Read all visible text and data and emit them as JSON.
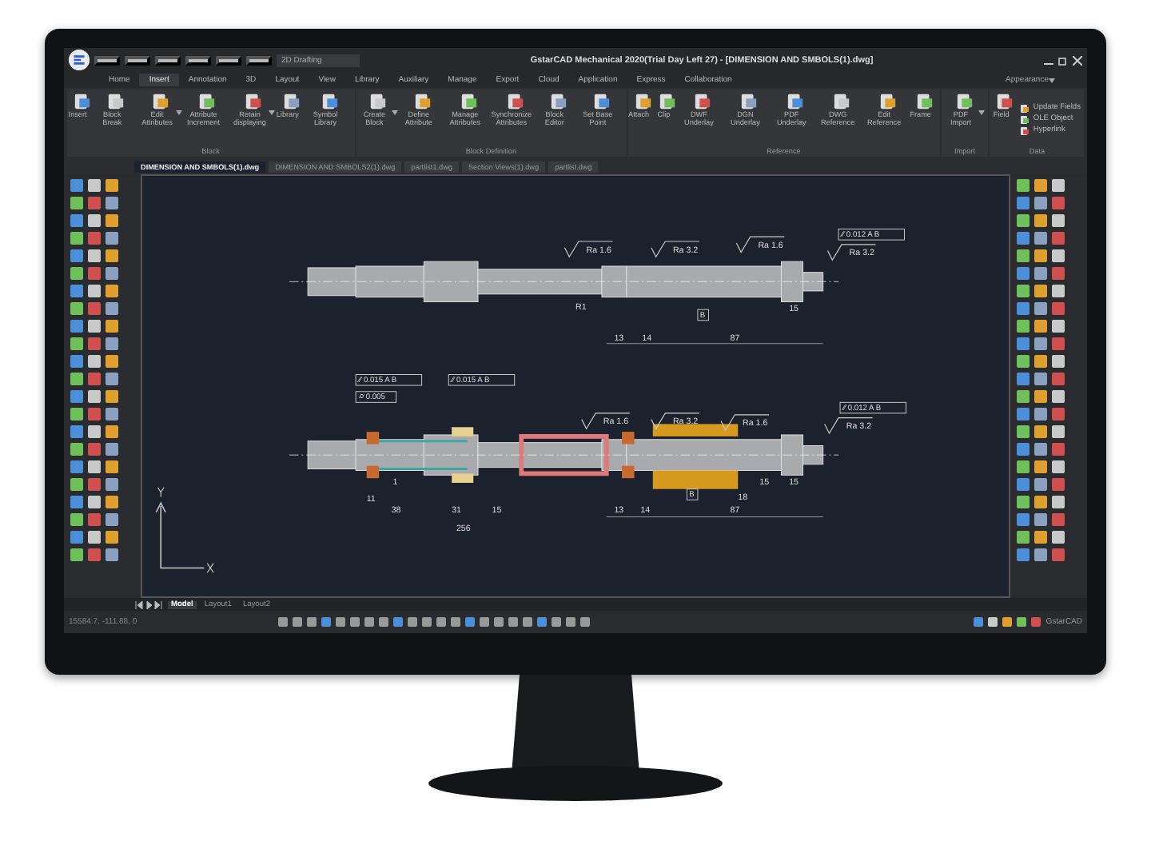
{
  "title_bar": {
    "workspace": "2D Drafting",
    "title": "GstarCAD Mechanical 2020(Trial Day Left 27) - [DIMENSION AND SMBOLS(1).dwg]"
  },
  "menu_tabs": [
    {
      "label": "Home",
      "selected": false
    },
    {
      "label": "Insert",
      "selected": true
    },
    {
      "label": "Annotation",
      "selected": false
    },
    {
      "label": "3D",
      "selected": false
    },
    {
      "label": "Layout",
      "selected": false
    },
    {
      "label": "View",
      "selected": false
    },
    {
      "label": "Library",
      "selected": false
    },
    {
      "label": "Auxiliary",
      "selected": false
    },
    {
      "label": "Manage",
      "selected": false
    },
    {
      "label": "Export",
      "selected": false
    },
    {
      "label": "Cloud",
      "selected": false
    },
    {
      "label": "Application",
      "selected": false
    },
    {
      "label": "Express",
      "selected": false
    },
    {
      "label": "Collaboration",
      "selected": false
    }
  ],
  "appearance": "Appearance",
  "ribbon_groups": [
    {
      "title": "Block",
      "buttons": [
        {
          "label": "Insert",
          "menu": false,
          "kind": "large"
        },
        {
          "label": "Block Break",
          "menu": false,
          "kind": "large"
        },
        {
          "label": "Edit Attributes",
          "menu": true,
          "kind": "large"
        },
        {
          "label": "Attribute Increment",
          "menu": false,
          "kind": "large"
        },
        {
          "label": "Retain displaying",
          "menu": true,
          "kind": "large"
        },
        {
          "label": "Library",
          "menu": false,
          "kind": "large"
        },
        {
          "label": "Symbol Library",
          "menu": false,
          "kind": "large"
        }
      ]
    },
    {
      "title": "Block Definition",
      "buttons": [
        {
          "label": "Create Block",
          "menu": true,
          "kind": "large"
        },
        {
          "label": "Define Attribute",
          "menu": false,
          "kind": "large"
        },
        {
          "label": "Manage Attributes",
          "menu": false,
          "kind": "large"
        },
        {
          "label": "Synchronize Attributes",
          "menu": false,
          "kind": "large"
        },
        {
          "label": "Block Editor",
          "menu": false,
          "kind": "large"
        },
        {
          "label": "Set Base Point",
          "menu": false,
          "kind": "large"
        }
      ]
    },
    {
      "title": "Reference",
      "buttons": [
        {
          "label": "Attach",
          "menu": false,
          "kind": "large"
        },
        {
          "label": "Clip",
          "menu": false,
          "kind": "large"
        },
        {
          "label": "DWF Underlay",
          "menu": false,
          "kind": "large"
        },
        {
          "label": "DGN Underlay",
          "menu": false,
          "kind": "large"
        },
        {
          "label": "PDF Underlay",
          "menu": false,
          "kind": "large"
        },
        {
          "label": "DWG Reference",
          "menu": false,
          "kind": "large"
        },
        {
          "label": "Edit Reference",
          "menu": false,
          "kind": "large"
        },
        {
          "label": "Frame",
          "menu": false,
          "kind": "large"
        }
      ]
    },
    {
      "title": "Import",
      "buttons": [
        {
          "label": "PDF Import",
          "menu": true,
          "kind": "large"
        }
      ]
    },
    {
      "title": "Data",
      "buttons": [
        {
          "label": "Field",
          "menu": false,
          "kind": "large"
        },
        {
          "label": "Update Fields",
          "kind": "small"
        },
        {
          "label": "OLE Object",
          "kind": "small"
        },
        {
          "label": "Hyperlink",
          "kind": "small"
        }
      ]
    }
  ],
  "doc_tabs": [
    {
      "label": "DIMENSION AND SMBOLS(1).dwg",
      "selected": true
    },
    {
      "label": "DIMENSION AND SMBOLS2(1).dwg",
      "selected": false
    },
    {
      "label": "partlist1.dwg",
      "selected": false
    },
    {
      "label": "Section Views(1).dwg",
      "selected": false
    },
    {
      "label": "partlist.dwg",
      "selected": false
    }
  ],
  "drawing": {
    "upper_labels": [
      {
        "kind": "roughness",
        "text": "Ra 1.6"
      },
      {
        "kind": "roughness",
        "text": "Ra 3.2"
      },
      {
        "kind": "roughness",
        "text": "Ra 1.6"
      },
      {
        "kind": "frame",
        "text": "⁄⁄ 0.012 A B"
      },
      {
        "kind": "roughness",
        "text": "Ra 3.2"
      },
      {
        "kind": "dim",
        "text": "R1"
      },
      {
        "kind": "datum",
        "text": "B"
      },
      {
        "kind": "dim",
        "text": "13"
      },
      {
        "kind": "dim",
        "text": "14"
      },
      {
        "kind": "dim",
        "text": "87"
      },
      {
        "kind": "dim",
        "text": "15"
      }
    ],
    "lower_labels": [
      {
        "kind": "frame",
        "text": "⁄⁄ 0.015 A B"
      },
      {
        "kind": "frame",
        "text": "⌭ 0.005"
      },
      {
        "kind": "frame",
        "text": "⁄⁄ 0.015 A B"
      },
      {
        "kind": "roughness",
        "text": "Ra 1.6"
      },
      {
        "kind": "roughness",
        "text": "Ra 3.2"
      },
      {
        "kind": "roughness",
        "text": "Ra 1.6"
      },
      {
        "kind": "frame",
        "text": "⁄⁄ 0.012 A B"
      },
      {
        "kind": "roughness",
        "text": "Ra 3.2"
      },
      {
        "kind": "dim",
        "text": "1"
      },
      {
        "kind": "dim",
        "text": "11"
      },
      {
        "kind": "dim",
        "text": "38"
      },
      {
        "kind": "dim",
        "text": "31"
      },
      {
        "kind": "dim",
        "text": "15"
      },
      {
        "kind": "dim",
        "text": "13"
      },
      {
        "kind": "dim",
        "text": "14"
      },
      {
        "kind": "dim",
        "text": "87"
      },
      {
        "kind": "dim",
        "text": "18"
      },
      {
        "kind": "dim",
        "text": "15"
      },
      {
        "kind": "dim",
        "text": "15"
      },
      {
        "kind": "datum",
        "text": "B"
      },
      {
        "kind": "dim",
        "text": "256"
      }
    ]
  },
  "layout_tabs": [
    {
      "label": "Model",
      "selected": true
    },
    {
      "label": "Layout1",
      "selected": false
    },
    {
      "label": "Layout2",
      "selected": false
    }
  ],
  "status_bar": {
    "coordinates": "15584.7, -111.88, 0",
    "brand": "GstarCAD"
  }
}
